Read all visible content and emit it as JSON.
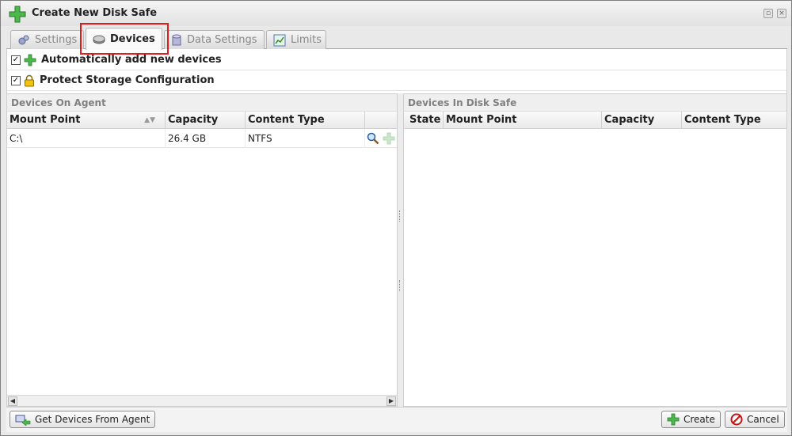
{
  "window": {
    "title": "Create New Disk Safe"
  },
  "tabs": [
    {
      "label": "Settings",
      "icon": "gears-icon"
    },
    {
      "label": "Devices",
      "icon": "disk-icon"
    },
    {
      "label": "Data Settings",
      "icon": "database-icon"
    },
    {
      "label": "Limits",
      "icon": "chart-icon"
    }
  ],
  "options": {
    "auto_add": {
      "label": "Automatically add new devices",
      "checked": true,
      "icon": "plus-icon"
    },
    "protect": {
      "label": "Protect Storage Configuration",
      "checked": true,
      "icon": "lock-icon"
    }
  },
  "left_panel": {
    "title": "Devices On Agent",
    "columns": [
      "Mount Point",
      "Capacity",
      "Content Type"
    ],
    "rows": [
      {
        "mount": "C:\\",
        "capacity": "26.4 GB",
        "content_type": "NTFS"
      }
    ]
  },
  "right_panel": {
    "title": "Devices In Disk Safe",
    "columns": [
      "State",
      "Mount Point",
      "Capacity",
      "Content Type"
    ]
  },
  "footer": {
    "get_devices": "Get Devices From Agent",
    "create": "Create",
    "cancel": "Cancel"
  },
  "colors": {
    "highlight": "#e01c1c",
    "plus_green": "#3aa83a",
    "cancel_red": "#cc1111"
  }
}
